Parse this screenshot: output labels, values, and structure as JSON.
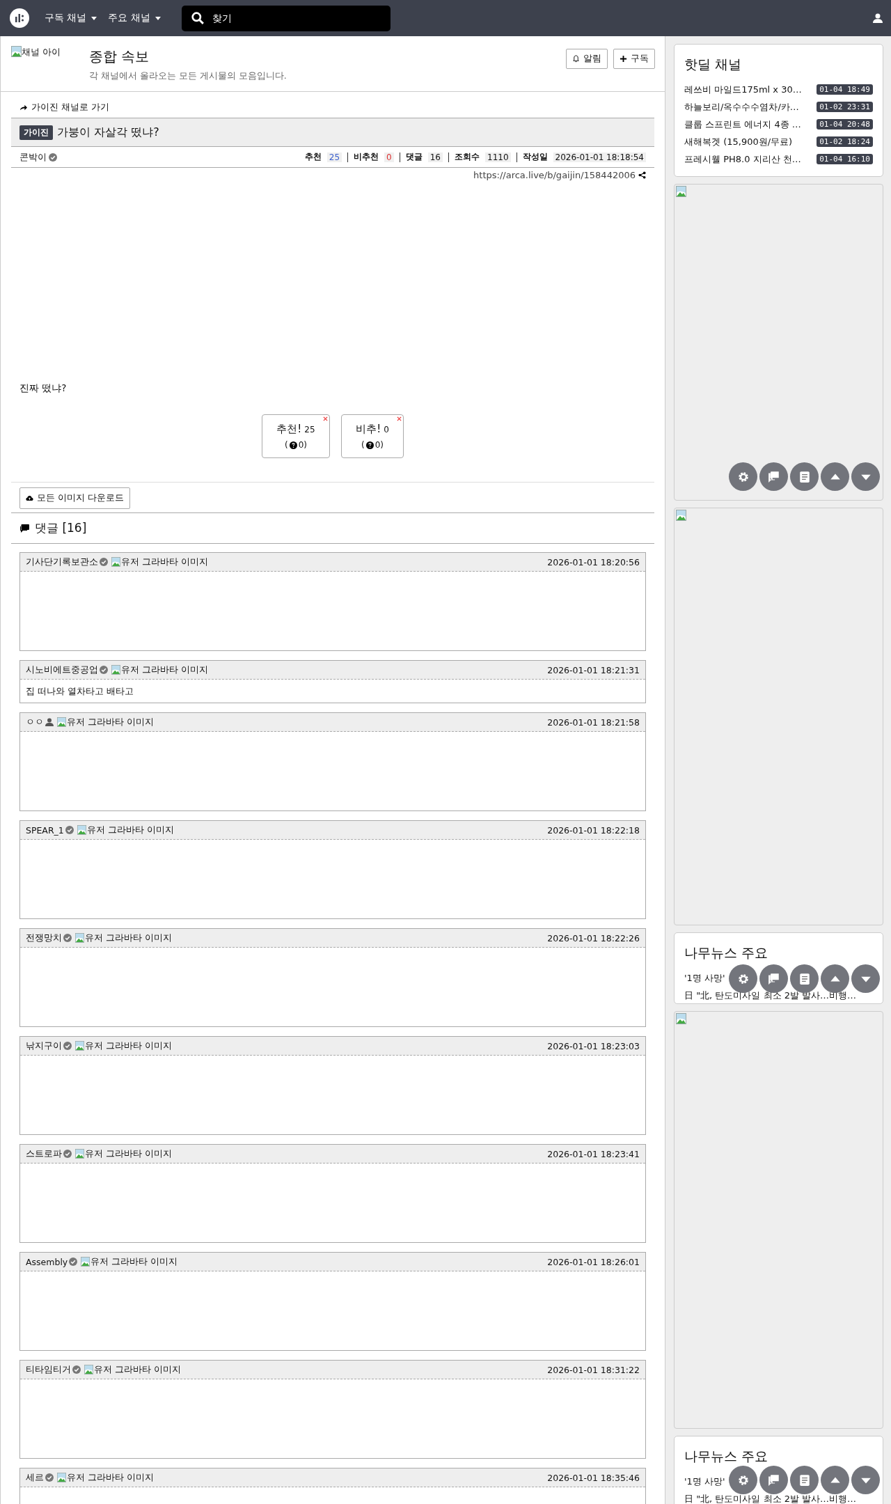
{
  "navbar": {
    "menus": [
      {
        "label": "구독 채널"
      },
      {
        "label": "주요 채널"
      }
    ],
    "search": {
      "placeholder": "찾기"
    }
  },
  "channel": {
    "icon_alt": "채널 아이",
    "title": "종합 속보",
    "description": "각 채널에서 올라오는 모든 게시물의 모음입니다.",
    "buttons": [
      {
        "kind": "bell",
        "label": "알림"
      },
      {
        "kind": "plus",
        "label": "구독"
      }
    ]
  },
  "post": {
    "channel_link": "가이진 채널로 가기",
    "badge": "가이진",
    "title": "가붕이 자살각 떴냐?",
    "author": "콘박이",
    "stats": [
      {
        "label": "추천",
        "value": "25",
        "color": "#3a5fcd"
      },
      {
        "label": "비추천",
        "value": "0",
        "color": "#dd3333"
      },
      {
        "label": "댓글",
        "value": "16",
        "color": "#111111"
      },
      {
        "label": "조회수",
        "value": "1110",
        "color": "#111111"
      },
      {
        "label": "작성일",
        "value": "2026-01-01 18:18:54",
        "color": "#111111"
      }
    ],
    "url": "https://arca.live/b/gaijin/158442006",
    "body": "진짜 떴냐?",
    "votes": [
      {
        "label": "추천!",
        "count": "25",
        "sub_open": "(",
        "sub": "0)"
      },
      {
        "label": "비추!",
        "count": "0",
        "sub_open": "(",
        "sub": "0)"
      }
    ],
    "download_button": "모든 이미지 다운로드"
  },
  "comments": {
    "heading": "댓글 [16]",
    "items": [
      {
        "author": "기사단기록보관소",
        "kind": "verified",
        "avatar_alt": "유저 그라바타 이미지",
        "time": "2026-01-01 18:20:56"
      },
      {
        "author": "시노비에트중공업",
        "kind": "verified",
        "avatar_alt": "유저 그라바타 이미지",
        "time": "2026-01-01 18:21:31",
        "text": "집 떠나와 열차타고 배타고"
      },
      {
        "author": "ㅇㅇ",
        "kind": "guest",
        "avatar_alt": "유저 그라바타 이미지",
        "time": "2026-01-01 18:21:58"
      },
      {
        "author": "SPEAR_1",
        "kind": "verified",
        "avatar_alt": "유저 그라바타 이미지",
        "time": "2026-01-01 18:22:18"
      },
      {
        "author": "전쟁망치",
        "kind": "verified",
        "avatar_alt": "유저 그라바타 이미지",
        "time": "2026-01-01 18:22:26"
      },
      {
        "author": "낚지구이",
        "kind": "verified",
        "avatar_alt": "유저 그라바타 이미지",
        "time": "2026-01-01 18:23:03"
      },
      {
        "author": "스트로파",
        "kind": "verified",
        "avatar_alt": "유저 그라바타 이미지",
        "time": "2026-01-01 18:23:41"
      },
      {
        "author": "Assembly",
        "kind": "verified",
        "avatar_alt": "유저 그라바타 이미지",
        "time": "2026-01-01 18:26:01"
      },
      {
        "author": "티타임티거",
        "kind": "verified",
        "avatar_alt": "유저 그라바타 이미지",
        "time": "2026-01-01 18:31:22"
      },
      {
        "author": "세르",
        "kind": "verified",
        "avatar_alt": "유저 그라바타 이미지",
        "time": "2026-01-01 18:35:46"
      }
    ]
  },
  "sidebar": [
    {
      "kind": "list",
      "title": "핫딜 채널",
      "items": [
        {
          "text": "레쓰비 마일드175ml x 30…",
          "time": "01-04 18:49"
        },
        {
          "text": "하늘보리/옥수수수염차/카…",
          "time": "01-02 23:31"
        },
        {
          "text": "클룹 스프린트 에너지 4종 …",
          "time": "01-04 20:48"
        },
        {
          "text": "새해복겟 (15,900원/무료)",
          "time": "01-02 18:24"
        },
        {
          "text": "프레시웰 PH8.0 지리산 천…",
          "time": "01-04 16:10"
        }
      ]
    },
    {
      "kind": "image"
    },
    {
      "kind": "image"
    },
    {
      "kind": "news",
      "title": "나무뉴스 주요",
      "items": [
        {
          "text": "'1명 사망'"
        },
        {
          "text": "日 \"北, 탄도미사일 최소 2발 발사…비행…"
        }
      ]
    },
    {
      "kind": "image"
    },
    {
      "kind": "news",
      "title": "나무뉴스 주요",
      "items": [
        {
          "text": "'1명 사망'"
        },
        {
          "text": "日 \"北, 탄도미사일 최소 2발 발사…비행…"
        }
      ]
    }
  ]
}
